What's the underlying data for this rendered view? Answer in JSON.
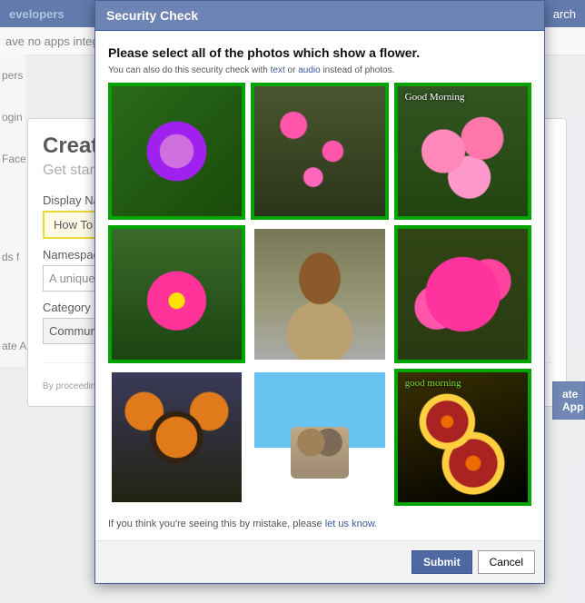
{
  "topbar": {
    "brand": "evelopers",
    "search": "arch"
  },
  "subbar": {
    "text": "ave no apps integ"
  },
  "sidebar": {
    "items": [
      "pers",
      "ogin",
      "Face",
      "ds f",
      "ate A"
    ]
  },
  "create": {
    "title": "Create",
    "subtitle": "Get started",
    "display_label": "Display Na",
    "howto_btn": "How To",
    "namespace_label": "Namespace",
    "namespace_placeholder": "A unique",
    "category_label": "Category",
    "category_value": "Commun",
    "proceeding": "By proceeding"
  },
  "rail": {
    "create_app": "ate App"
  },
  "modal": {
    "title": "Security Check",
    "instruction": "Please select all of the photos which show a flower.",
    "alt_prefix": "You can also do this security check with ",
    "alt_text": "text",
    "alt_or": " or ",
    "alt_audio": "audio",
    "alt_suffix": " instead of photos.",
    "mistake_prefix": "If you think you're seeing this by mistake, please ",
    "mistake_link": "let us know",
    "mistake_suffix": ".",
    "submit": "Submit",
    "cancel": "Cancel",
    "tiles": [
      {
        "name": "purple-flower",
        "selected": true,
        "caption": ""
      },
      {
        "name": "fuchsia-flowers",
        "selected": true,
        "caption": ""
      },
      {
        "name": "pink-roses-good-morning",
        "selected": true,
        "caption": "Good Morning"
      },
      {
        "name": "pink-cosmos-flower",
        "selected": true,
        "caption": ""
      },
      {
        "name": "lion",
        "selected": false,
        "caption": ""
      },
      {
        "name": "pink-phlox-flowers",
        "selected": true,
        "caption": ""
      },
      {
        "name": "tigers",
        "selected": false,
        "caption": ""
      },
      {
        "name": "cats-in-box",
        "selected": false,
        "caption": ""
      },
      {
        "name": "blanket-flowers-good-morning",
        "selected": true,
        "caption": "good    morning"
      }
    ]
  }
}
